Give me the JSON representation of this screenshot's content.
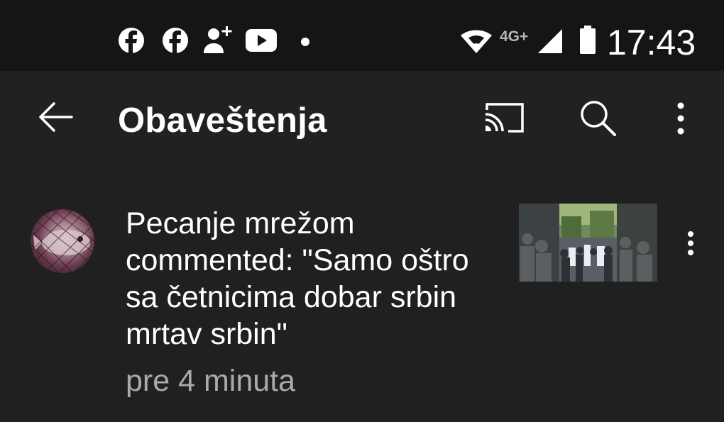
{
  "status_bar": {
    "time": "17:43",
    "network_label": "4G+",
    "notification_icons": [
      "facebook-icon",
      "facebook-icon",
      "add-contact-icon",
      "youtube-icon"
    ],
    "system_icons": [
      "wifi-icon",
      "signal-icon",
      "battery-icon"
    ]
  },
  "app_bar": {
    "title": "Obaveštenja",
    "icons": [
      "back-arrow-icon",
      "cast-icon",
      "search-icon",
      "more-vert-icon"
    ]
  },
  "notifications": [
    {
      "channel": "Pecanje mrežom",
      "action": "commented:",
      "comment": "\"Samo oštro sa četnicima dobar srbin mrtav srbin\"",
      "full_text": "Pecanje mrežom commented: \"Samo oštro sa četnicima dobar srbin mrtav srbin\"",
      "time": "pre 4 minuta"
    }
  ],
  "colors": {
    "status_bar_bg": "#151515",
    "app_bar_bg": "#212121",
    "content_bg": "#202020",
    "primary_text": "#ffffff",
    "secondary_text": "#aaaaaa"
  }
}
